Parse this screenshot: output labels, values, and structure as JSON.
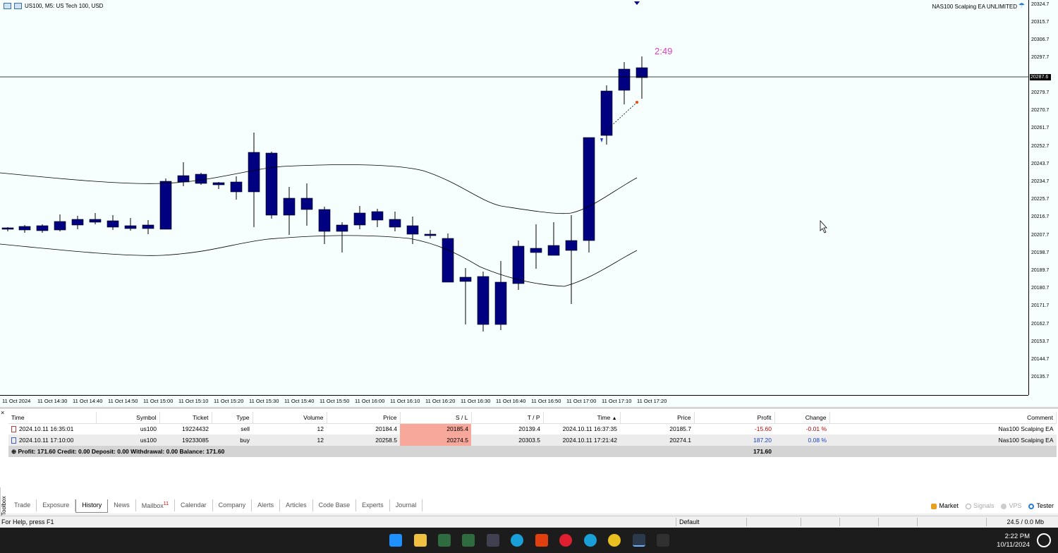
{
  "chart": {
    "symbol_title": "US100, M5:  US Tech 100, USD",
    "ea_name": "NAS100 Scalping EA UNLIMITED",
    "timer": "2:49",
    "current_price": "20287.6",
    "price_labels": [
      "20324.7",
      "20315.7",
      "20306.7",
      "20297.7",
      "20287.6",
      "20279.7",
      "20270.7",
      "20261.7",
      "20252.7",
      "20243.7",
      "20234.7",
      "20225.7",
      "20216.7",
      "20207.7",
      "20198.7",
      "20189.7",
      "20180.7",
      "20171.7",
      "20162.7",
      "20153.7",
      "20144.7",
      "20135.7"
    ],
    "time_labels": [
      "11 Oct 2024",
      "11 Oct 14:30",
      "11 Oct 14:40",
      "11 Oct 14:50",
      "11 Oct 15:00",
      "11 Oct 15:10",
      "11 Oct 15:20",
      "11 Oct 15:30",
      "11 Oct 15:40",
      "11 Oct 15:50",
      "11 Oct 16:00",
      "11 Oct 16:10",
      "11 Oct 16:20",
      "11 Oct 16:30",
      "11 Oct 16:40",
      "11 Oct 16:50",
      "11 Oct 17:00",
      "11 Oct 17:10",
      "11 Oct 17:20"
    ],
    "colors": {
      "candle": "#000080",
      "background": "#f6fffd",
      "timer": "#e040c0"
    }
  },
  "history": {
    "columns": [
      "Time",
      "Symbol",
      "Ticket",
      "Type",
      "Volume",
      "Price",
      "S / L",
      "T / P",
      "Time",
      "Price",
      "Profit",
      "Change",
      "Comment"
    ],
    "sorted_column_marker": "▲",
    "rows": [
      {
        "time": "2024.10.11 16:35:01",
        "symbol": "us100",
        "ticket": "19224432",
        "type": "sell",
        "volume": "12",
        "price": "20184.4",
        "sl": "20185.4",
        "tp": "20139.4",
        "close_time": "2024.10.11 16:37:35",
        "close_price": "20185.7",
        "profit": "-15.60",
        "change": "-0.01 %",
        "comment": "Nas100 Scalping EA"
      },
      {
        "time": "2024.10.11 17:10:00",
        "symbol": "us100",
        "ticket": "19233085",
        "type": "buy",
        "volume": "12",
        "price": "20258.5",
        "sl": "20274.5",
        "tp": "20303.5",
        "close_time": "2024.10.11 17:21:42",
        "close_price": "20274.1",
        "profit": "187.20",
        "change": "0.08 %",
        "comment": "Nas100 Scalping EA"
      }
    ],
    "summary": "Profit: 171.60  Credit: 0.00  Deposit: 0.00  Withdrawal: 0.00  Balance: 171.60",
    "summary_total": "171.60"
  },
  "toolbox_label": "Toolbox",
  "tabs": [
    {
      "label": "Trade",
      "active": false
    },
    {
      "label": "Exposure",
      "active": false
    },
    {
      "label": "History",
      "active": true
    },
    {
      "label": "News",
      "active": false
    },
    {
      "label": "Mailbox",
      "badge": "11",
      "active": false
    },
    {
      "label": "Calendar",
      "active": false
    },
    {
      "label": "Company",
      "active": false
    },
    {
      "label": "Alerts",
      "active": false
    },
    {
      "label": "Articles",
      "active": false
    },
    {
      "label": "Code Base",
      "active": false
    },
    {
      "label": "Experts",
      "active": false
    },
    {
      "label": "Journal",
      "active": false
    }
  ],
  "right_tabs": {
    "market": "Market",
    "signals": "Signals",
    "vps": "VPS",
    "tester": "Tester"
  },
  "statusbar": {
    "help": "For Help, press F1",
    "profile": "Default",
    "traffic": "24.5 / 0.0 Mb"
  },
  "taskbar": {
    "time": "2:22 PM",
    "date": "10/11/2024"
  }
}
